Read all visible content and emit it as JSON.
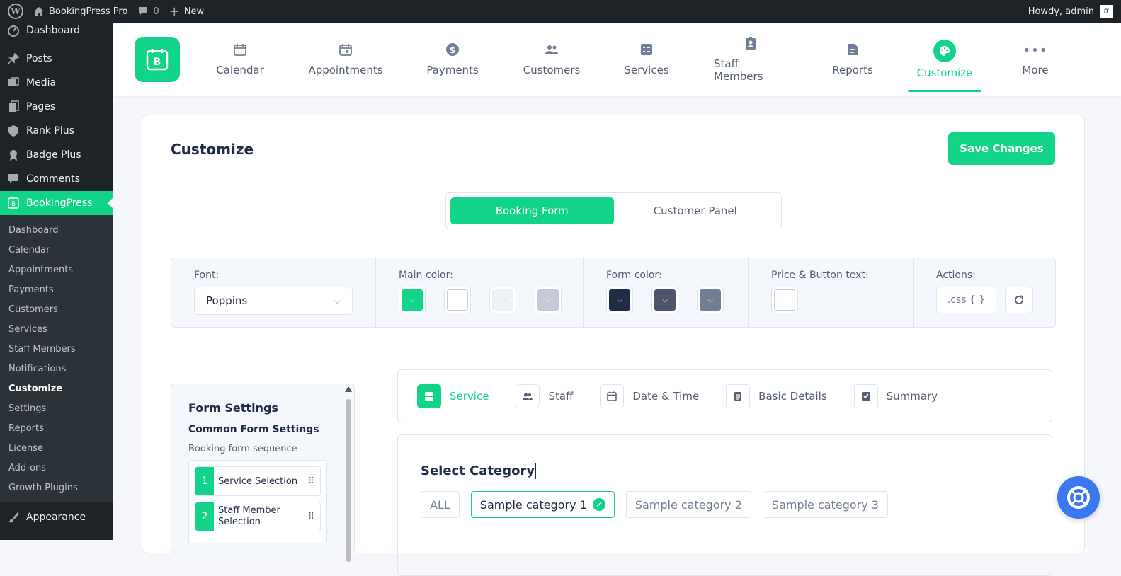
{
  "adminbar": {
    "site": "BookingPress Pro",
    "comments": "0",
    "new": "New",
    "howdy": "Howdy, admin"
  },
  "sidebar": {
    "top": [
      {
        "label": "Dashboard",
        "icon": "dashboard-icon"
      },
      {
        "label": "Posts",
        "icon": "pin-icon"
      },
      {
        "label": "Media",
        "icon": "media-icon"
      },
      {
        "label": "Pages",
        "icon": "pages-icon"
      },
      {
        "label": "Rank Plus",
        "icon": "shield-icon"
      },
      {
        "label": "Badge Plus",
        "icon": "badge-icon"
      },
      {
        "label": "Comments",
        "icon": "comment-icon"
      }
    ],
    "active": "BookingPress",
    "sub": [
      "Dashboard",
      "Calendar",
      "Appointments",
      "Payments",
      "Customers",
      "Services",
      "Staff Members",
      "Notifications",
      "Customize",
      "Settings",
      "Reports",
      "License",
      "Add-ons",
      "Growth Plugins"
    ],
    "current_sub": "Customize",
    "bottom": "Appearance"
  },
  "nav": [
    {
      "label": "Calendar",
      "icon": "calendar-icon"
    },
    {
      "label": "Appointments",
      "icon": "calendar-check-icon"
    },
    {
      "label": "Payments",
      "icon": "dollar-icon"
    },
    {
      "label": "Customers",
      "icon": "users-icon"
    },
    {
      "label": "Services",
      "icon": "services-icon"
    },
    {
      "label": "Staff Members",
      "icon": "id-badge-icon"
    },
    {
      "label": "Reports",
      "icon": "report-icon"
    },
    {
      "label": "Customize",
      "icon": "palette-icon"
    },
    {
      "label": "More",
      "icon": "more-icon"
    }
  ],
  "nav_active": "Customize",
  "page": {
    "title": "Customize",
    "save": "Save Changes"
  },
  "toggle": {
    "left": "Booking Form",
    "right": "Customer Panel",
    "selected": "Booking Form"
  },
  "toolbar": {
    "font_label": "Font:",
    "font_value": "Poppins",
    "main_label": "Main color:",
    "form_label": "Form color:",
    "price_label": "Price & Button text:",
    "actions_label": "Actions:",
    "css": ".css { }",
    "main_colors": [
      "#12d488",
      "#ffffff",
      "#eef1f5",
      "#c5cad6"
    ],
    "form_colors": [
      "#202c45",
      "#4c556b",
      "#727e95"
    ],
    "price_color": "#ffffff"
  },
  "panel": {
    "title": "Form Settings",
    "subtitle": "Common Form Settings",
    "seq_label": "Booking form sequence",
    "seq": [
      {
        "n": "1",
        "label": "Service Selection"
      },
      {
        "n": "2",
        "label": "Staff Member Selection"
      }
    ]
  },
  "steps": [
    {
      "label": "Service",
      "icon": "service-icon"
    },
    {
      "label": "Staff",
      "icon": "staff-icon"
    },
    {
      "label": "Date & Time",
      "icon": "calendar-icon"
    },
    {
      "label": "Basic Details",
      "icon": "document-icon"
    },
    {
      "label": "Summary",
      "icon": "checkbox-icon"
    }
  ],
  "category": {
    "title": "Select Category",
    "chips": [
      "ALL",
      "Sample category 1",
      "Sample category 2",
      "Sample category 3"
    ],
    "selected": "Sample category 1"
  }
}
